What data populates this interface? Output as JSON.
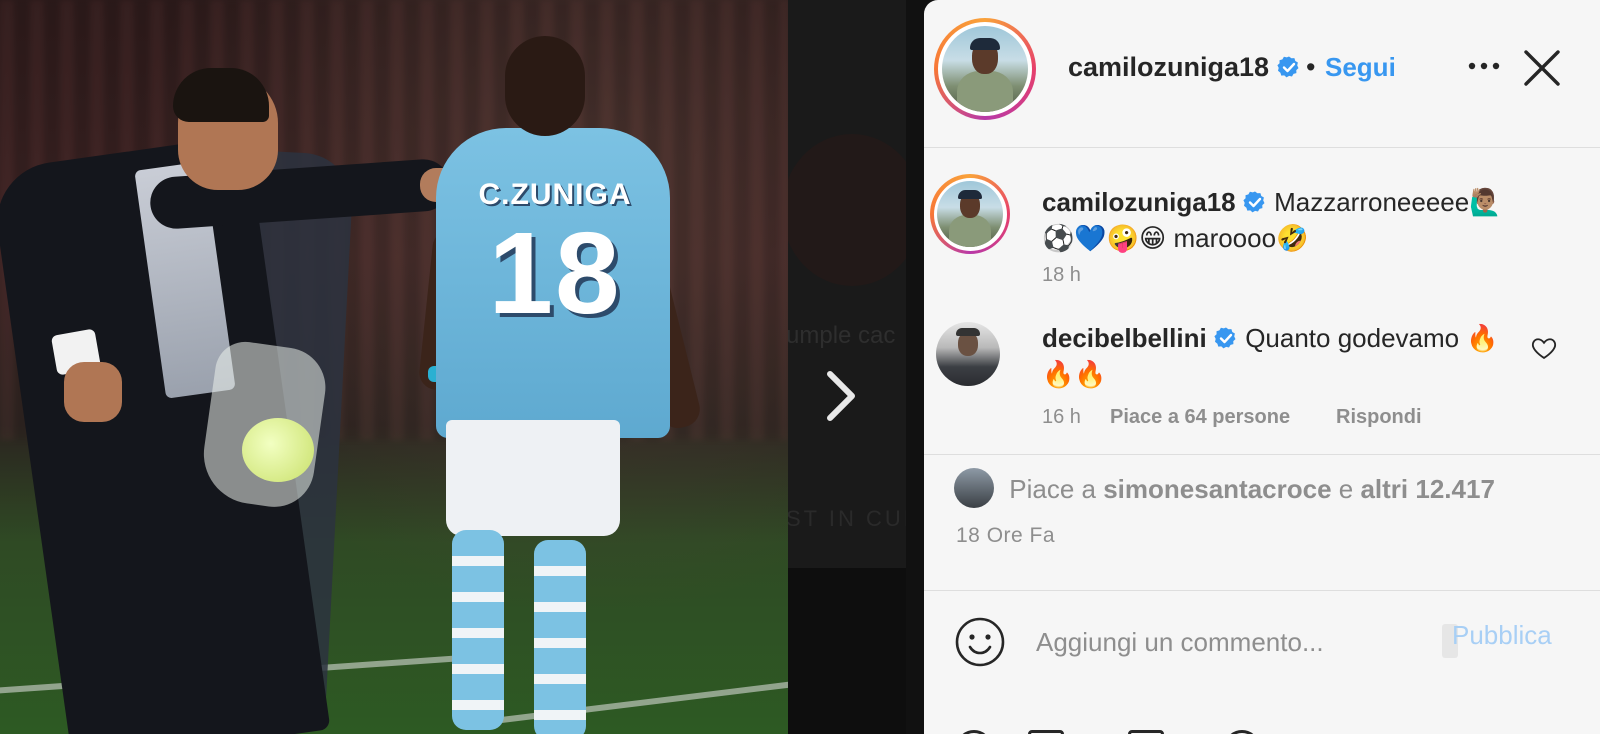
{
  "post_image": {
    "jersey_name": "C.ZUNIGA",
    "jersey_number": "18"
  },
  "next_preview": {
    "text_line1": "umple cac",
    "text_line2": "ST IN CUI"
  },
  "header": {
    "username": "camilozuniga18",
    "separator": "•",
    "follow_label": "Segui"
  },
  "caption": {
    "username": "camilozuniga18",
    "text_line1": "Mazzarroneeeee🙋🏽‍♂️",
    "text_line2": "⚽💙🤪😁 maroooo🤣",
    "time": "18 h"
  },
  "comments": [
    {
      "username": "decibelbellini",
      "text": "Quanto godevamo 🔥",
      "text_line2": "🔥🔥",
      "time": "16 h",
      "likes": "Piace a 64 persone",
      "reply_label": "Rispondi"
    }
  ],
  "likes": {
    "prefix": "Piace a",
    "user": "simonesantacroce",
    "conj": "e",
    "others": "altri 12.417"
  },
  "posted_ago": "18 Ore Fa",
  "comment_box": {
    "placeholder": "Aggiungi un commento...",
    "publish_label": "Pubblica"
  },
  "colors": {
    "accent": "#3897f0",
    "publish_disabled": "#a8cff5",
    "text": "#262626",
    "muted": "#8e8e8e"
  }
}
